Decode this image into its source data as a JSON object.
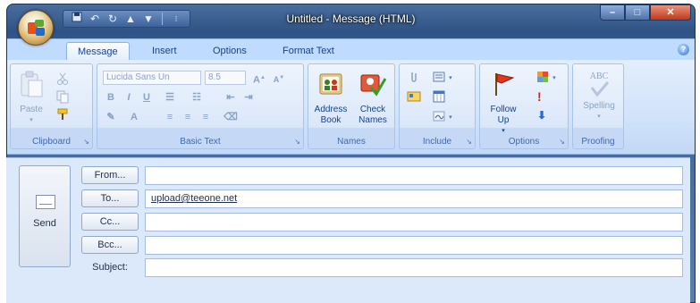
{
  "window": {
    "title": "Untitled - Message (HTML)"
  },
  "quick_access": {
    "icons": [
      "save-icon",
      "undo-icon",
      "redo-icon",
      "up-arrow-icon",
      "down-arrow-icon",
      "customize-icon"
    ]
  },
  "tabs": [
    {
      "label": "Message",
      "active": true
    },
    {
      "label": "Insert",
      "active": false
    },
    {
      "label": "Options",
      "active": false
    },
    {
      "label": "Format Text",
      "active": false
    }
  ],
  "ribbon": {
    "clipboard": {
      "label": "Clipboard",
      "paste_label": "Paste"
    },
    "basic_text": {
      "label": "Basic Text",
      "font_name": "Lucida Sans Un",
      "font_size": "8.5"
    },
    "names": {
      "label": "Names",
      "address_book": "Address Book",
      "check_names": "Check Names"
    },
    "include": {
      "label": "Include"
    },
    "options": {
      "label": "Options",
      "follow_up": "Follow Up"
    },
    "proofing": {
      "label": "Proofing",
      "spelling": "Spelling",
      "abc": "ABC"
    }
  },
  "form": {
    "send_label": "Send",
    "from_label": "From...",
    "to_label": "To...",
    "cc_label": "Cc...",
    "bcc_label": "Bcc...",
    "subject_label": "Subject:",
    "from_value": "",
    "to_value": "upload@teeone.net",
    "cc_value": "",
    "bcc_value": "",
    "subject_value": ""
  },
  "colors": {
    "title_bar": "#2f5385",
    "ribbon_bg": "#d2e3fa",
    "tab_text": "#15428b",
    "close_button": "#c0391b"
  }
}
